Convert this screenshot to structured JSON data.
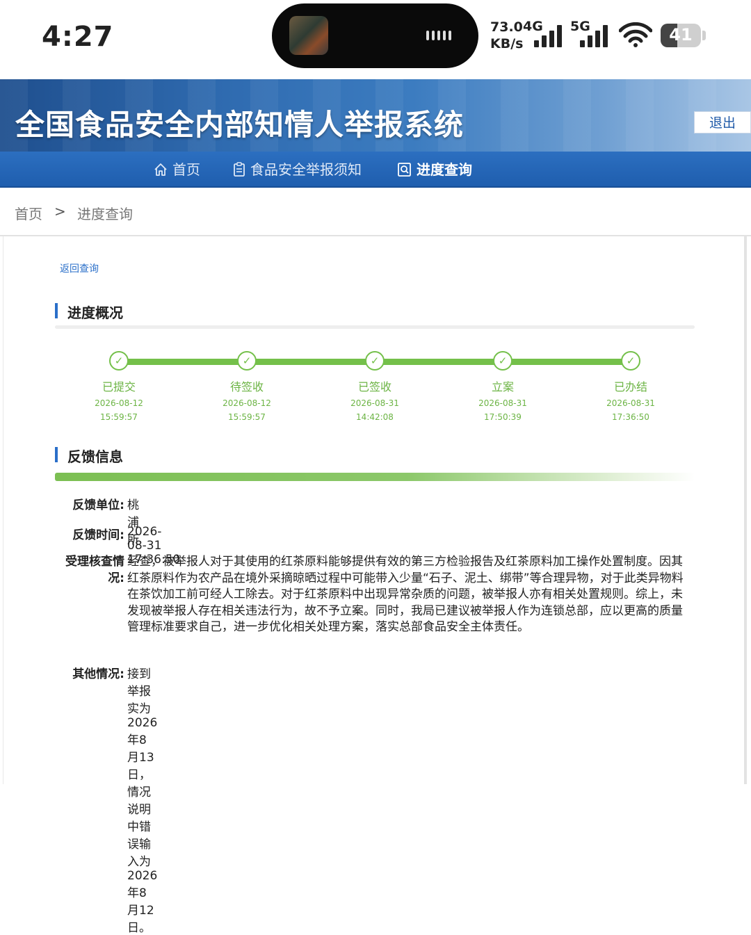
{
  "status_bar": {
    "time": "4:27",
    "speed_value": "73.0",
    "speed_unit": "KB/s",
    "net1": "4G",
    "net2": "5G",
    "battery": "41",
    "battery_level": 0.41
  },
  "header": {
    "title": "全国食品安全内部知情人举报系统",
    "logout_label": "退出"
  },
  "nav": {
    "items": [
      {
        "label": "首页",
        "icon": "home-icon"
      },
      {
        "label": "食品安全举报须知",
        "icon": "clipboard-icon"
      },
      {
        "label": "进度查询",
        "icon": "search-doc-icon"
      }
    ]
  },
  "breadcrumb": {
    "home": "首页",
    "separator": ">",
    "current": "进度查询"
  },
  "back_link": "返回查询",
  "progress": {
    "title": "进度概况",
    "accent_color": "#74c04a",
    "steps": [
      {
        "label": "已提交",
        "date": "2026-08-12",
        "time": "15:59:57"
      },
      {
        "label": "待签收",
        "date": "2026-08-12",
        "time": "15:59:57"
      },
      {
        "label": "已签收",
        "date": "2026-08-31",
        "time": "14:42:08"
      },
      {
        "label": "立案",
        "date": "2026-08-31",
        "time": "17:50:39"
      },
      {
        "label": "已办结",
        "date": "2026-08-31",
        "time": "17:36:50"
      }
    ]
  },
  "feedback": {
    "title": "反馈信息",
    "unit_label": "反馈单位:",
    "unit_value": "桃浦所",
    "time_label": "反馈时间:",
    "time_value": "2026-08-31 17:36:50",
    "verify_label": "受理核查情况:",
    "verify_value": "经查，被举报人对于其使用的红茶原料能够提供有效的第三方检验报告及红茶原料加工操作处置制度。因其红茶原料作为农产品在境外采摘晾晒过程中可能带入少量“石子、泥土、绑带”等合理异物，对于此类异物料在茶饮加工前可经人工除去。对于红茶原料中出现异常杂质的问题，被举报人亦有相关处置规则。综上，未发现被举报人存在相关违法行为，故不予立案。同时，我局已建议被举报人作为连锁总部，应以更高的质量管理标准要求自己，进一步优化相关处理方案，落实总部食品安全主体责任。",
    "other_label": "其他情况:",
    "other_value": "接到举报实为2026年8月13日，情况说明中错误输入为2026年8月12日。"
  }
}
